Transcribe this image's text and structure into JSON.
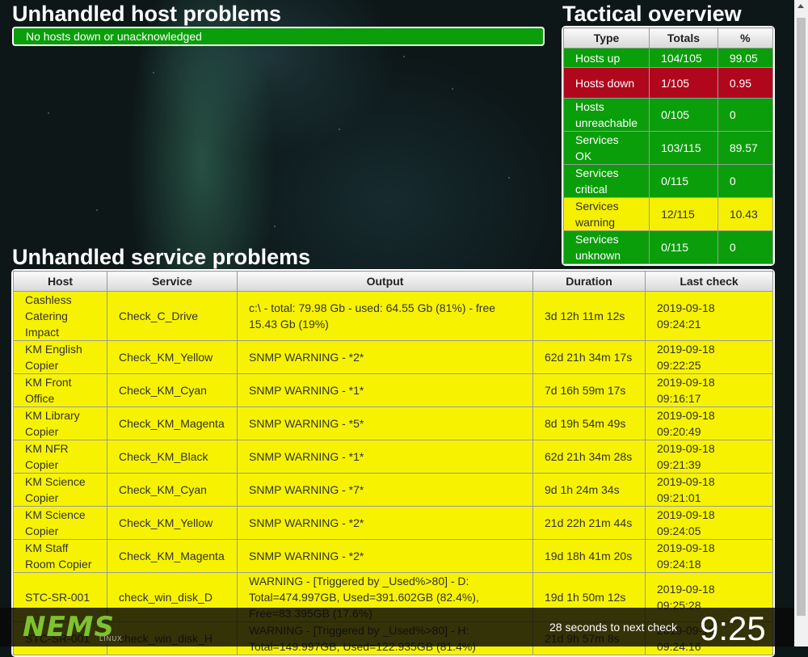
{
  "host_problems": {
    "title": "Unhandled host problems",
    "status": "No hosts down or unacknowledged"
  },
  "tactical": {
    "title": "Tactical overview",
    "headers": [
      "Type",
      "Totals",
      "%"
    ],
    "rows": [
      {
        "type": "Hosts up",
        "totals": "104/105",
        "pct": "99.05",
        "status": "green"
      },
      {
        "type": "Hosts down",
        "totals": "1/105",
        "pct": "0.95",
        "status": "red"
      },
      {
        "type": "Hosts unreachable",
        "totals": "0/105",
        "pct": "0",
        "status": "green"
      },
      {
        "type": "Services OK",
        "totals": "103/115",
        "pct": "89.57",
        "status": "green"
      },
      {
        "type": "Services critical",
        "totals": "0/115",
        "pct": "0",
        "status": "green"
      },
      {
        "type": "Services warning",
        "totals": "12/115",
        "pct": "10.43",
        "status": "yellow"
      },
      {
        "type": "Services unknown",
        "totals": "0/115",
        "pct": "0",
        "status": "green"
      }
    ]
  },
  "services": {
    "title": "Unhandled service problems",
    "headers": [
      "Host",
      "Service",
      "Output",
      "Duration",
      "Last check"
    ],
    "rows": [
      {
        "host": "Cashless Catering Impact",
        "service": "Check_C_Drive",
        "output": "c:\\ - total: 79.98 Gb - used: 64.55 Gb (81%) - free 15.43 Gb (19%)",
        "duration": "3d 12h 11m 12s",
        "last_check": "2019-09-18 09:24:21"
      },
      {
        "host": "KM English Copier",
        "service": "Check_KM_Yellow",
        "output": "SNMP WARNING - *2*",
        "duration": "62d 21h 34m 17s",
        "last_check": "2019-09-18 09:22:25"
      },
      {
        "host": "KM Front Office",
        "service": "Check_KM_Cyan",
        "output": "SNMP WARNING - *1*",
        "duration": "7d 16h 59m 17s",
        "last_check": "2019-09-18 09:16:17"
      },
      {
        "host": "KM Library Copier",
        "service": "Check_KM_Magenta",
        "output": "SNMP WARNING - *5*",
        "duration": "8d 19h 54m 49s",
        "last_check": "2019-09-18 09:20:49"
      },
      {
        "host": "KM NFR Copier",
        "service": "Check_KM_Black",
        "output": "SNMP WARNING - *1*",
        "duration": "62d 21h 34m 28s",
        "last_check": "2019-09-18 09:21:39"
      },
      {
        "host": "KM Science Copier",
        "service": "Check_KM_Cyan",
        "output": "SNMP WARNING - *7*",
        "duration": "9d 1h 24m 34s",
        "last_check": "2019-09-18 09:21:01"
      },
      {
        "host": "KM Science Copier",
        "service": "Check_KM_Yellow",
        "output": "SNMP WARNING - *2*",
        "duration": "21d 22h 21m 44s",
        "last_check": "2019-09-18 09:24:05"
      },
      {
        "host": "KM Staff Room Copier",
        "service": "Check_KM_Magenta",
        "output": "SNMP WARNING - *2*",
        "duration": "19d 18h 41m 20s",
        "last_check": "2019-09-18 09:24:18"
      },
      {
        "host": "STC-SR-001",
        "service": "check_win_disk_D",
        "output": "WARNING - [Triggered by _Used%>80] - D: Total=474.997GB, Used=391.602GB (82.4%), Free=83.395GB (17.6%)",
        "duration": "19d 1h 50m 12s",
        "last_check": "2019-09-18 09:25:28"
      },
      {
        "host": "STC-SR-001",
        "service": "check_win_disk_H",
        "output": "WARNING - [Triggered by _Used%>80] - H: Total=149.997GB, Used=122.935GB (81.4%)",
        "duration": "21d 9h 57m 8s",
        "last_check": "2019-09-18 09:24:16"
      }
    ]
  },
  "footer": {
    "logo": "NEMS",
    "logo_sub": "LINUX",
    "next_check": "28 seconds to next check",
    "clock": "9:25"
  },
  "colors": {
    "ok": "#0a9e0a",
    "critical": "#b0071d",
    "warning": "#f7f300"
  }
}
